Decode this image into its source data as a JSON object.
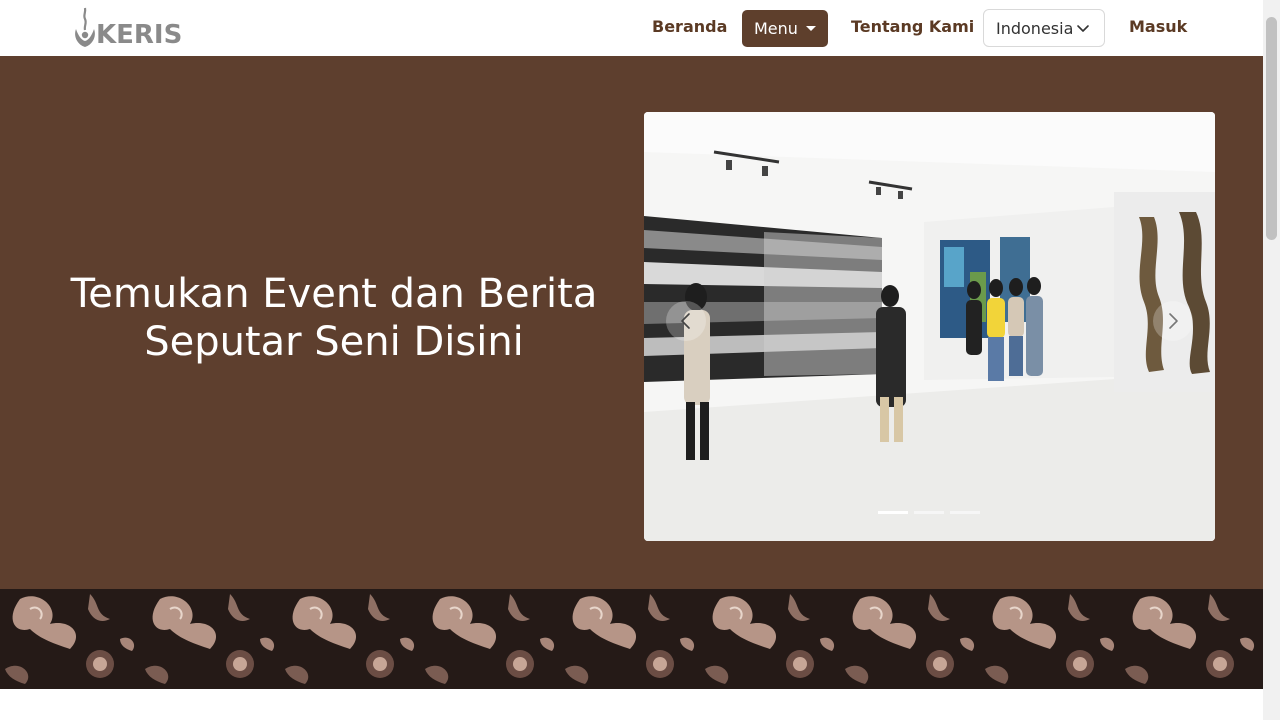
{
  "brand": {
    "name": "KERIS"
  },
  "nav": {
    "beranda": "Beranda",
    "menu": "Menu",
    "tentang": "Tentang Kami",
    "language": "Indonesia",
    "masuk": "Masuk"
  },
  "hero": {
    "title_line1": "Temukan Event dan Berita",
    "title_line2": "Seputar Seni Disini"
  },
  "carousel": {
    "slide_count": 3,
    "active_index": 0,
    "prev_icon": "chevron-left-icon",
    "next_icon": "chevron-right-icon"
  },
  "colors": {
    "brand_brown": "#5e3f2c",
    "hero_bg": "#5e3f2e",
    "logo_gray": "#8a8a8a"
  }
}
